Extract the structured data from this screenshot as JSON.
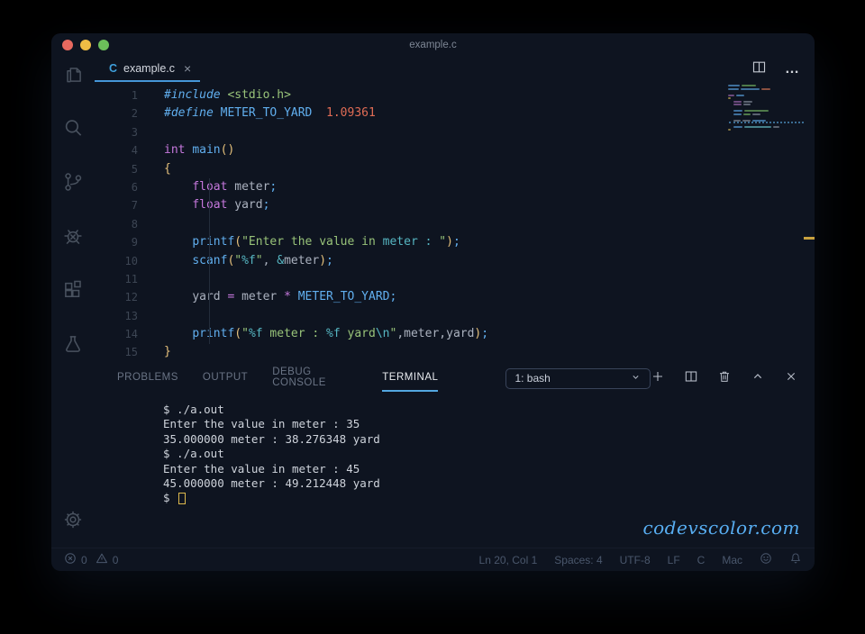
{
  "window": {
    "title": "example.c"
  },
  "tab": {
    "label": "example.c",
    "lang_badge": "C",
    "close_glyph": "×"
  },
  "editor": {
    "lines": [
      {
        "n": "1",
        "tokens": [
          [
            "#include ",
            "dir"
          ],
          [
            "<stdio.h>",
            "str"
          ]
        ]
      },
      {
        "n": "2",
        "tokens": [
          [
            "#define ",
            "dir"
          ],
          [
            "METER_TO_YARD",
            "macro"
          ],
          [
            "  ",
            "pln"
          ],
          [
            "1.09361",
            "num"
          ]
        ]
      },
      {
        "n": "3",
        "tokens": []
      },
      {
        "n": "4",
        "tokens": [
          [
            "int ",
            "kw"
          ],
          [
            "main",
            "fn"
          ],
          [
            "()",
            "br"
          ]
        ]
      },
      {
        "n": "5",
        "tokens": [
          [
            "{",
            "br"
          ]
        ]
      },
      {
        "n": "6",
        "tokens": [
          [
            "    ",
            "pln"
          ],
          [
            "float ",
            "kw"
          ],
          [
            "meter",
            "pln"
          ],
          [
            ";",
            "pun"
          ]
        ]
      },
      {
        "n": "7",
        "tokens": [
          [
            "    ",
            "pln"
          ],
          [
            "float ",
            "kw"
          ],
          [
            "yard",
            "pln"
          ],
          [
            ";",
            "pun"
          ]
        ]
      },
      {
        "n": "8",
        "tokens": []
      },
      {
        "n": "9",
        "tokens": [
          [
            "    ",
            "pln"
          ],
          [
            "printf",
            "fn"
          ],
          [
            "(",
            "br"
          ],
          [
            "\"Enter the value in ",
            "str"
          ],
          [
            "meter : ",
            "esc"
          ],
          [
            "\"",
            "str"
          ],
          [
            ")",
            "br"
          ],
          [
            ";",
            "pun"
          ]
        ]
      },
      {
        "n": "10",
        "tokens": [
          [
            "    ",
            "pln"
          ],
          [
            "scanf",
            "fn"
          ],
          [
            "(",
            "br"
          ],
          [
            "\"",
            "str"
          ],
          [
            "%f",
            "esc"
          ],
          [
            "\"",
            "str"
          ],
          [
            ", ",
            "pln"
          ],
          [
            "&",
            "esc"
          ],
          [
            "meter",
            "pln"
          ],
          [
            ")",
            "br"
          ],
          [
            ";",
            "pun"
          ]
        ]
      },
      {
        "n": "11",
        "tokens": []
      },
      {
        "n": "12",
        "tokens": [
          [
            "    ",
            "pln"
          ],
          [
            "yard ",
            "pln"
          ],
          [
            "=",
            "opr"
          ],
          [
            " meter ",
            "pln"
          ],
          [
            "*",
            "opr"
          ],
          [
            " ",
            "pln"
          ],
          [
            "METER_TO_YARD",
            "macro"
          ],
          [
            ";",
            "pun"
          ]
        ]
      },
      {
        "n": "13",
        "tokens": []
      },
      {
        "n": "14",
        "tokens": [
          [
            "    ",
            "pln"
          ],
          [
            "printf",
            "fn"
          ],
          [
            "(",
            "br"
          ],
          [
            "\"",
            "str"
          ],
          [
            "%f",
            "esc"
          ],
          [
            " meter : ",
            "str"
          ],
          [
            "%f",
            "esc"
          ],
          [
            " yard",
            "str"
          ],
          [
            "\\n",
            "esc"
          ],
          [
            "\"",
            "str"
          ],
          [
            ",meter,yard",
            "pln"
          ],
          [
            ")",
            "br"
          ],
          [
            ";",
            "pun"
          ]
        ]
      },
      {
        "n": "15",
        "tokens": [
          [
            "}",
            "br"
          ]
        ]
      }
    ]
  },
  "panel": {
    "tabs": [
      {
        "label": "PROBLEMS",
        "active": false
      },
      {
        "label": "OUTPUT",
        "active": false
      },
      {
        "label": "DEBUG CONSOLE",
        "active": false
      },
      {
        "label": "TERMINAL",
        "active": true
      }
    ],
    "dropdown_label": "1: bash"
  },
  "terminal": {
    "lines": [
      "$ ./a.out",
      "Enter the value in meter : 35",
      "35.000000 meter : 38.276348 yard",
      "$ ./a.out",
      "Enter the value in meter : 45",
      "45.000000 meter : 49.212448 yard"
    ],
    "last_prompt": "$ "
  },
  "watermark": "codevscolor.com",
  "status_bar": {
    "errors": "0",
    "warnings": "0",
    "items": [
      "Ln 20, Col 1",
      "Spaces: 4",
      "UTF-8",
      "LF",
      "C",
      "Mac"
    ]
  },
  "colors": {
    "accent_blue": "#4596d8",
    "terminal_underline": "#53a7e0",
    "string_green": "#98c379",
    "keyword_purple": "#c678dd",
    "function_blue": "#61afef",
    "number_orange": "#e06c55",
    "format_teal": "#56b6c2",
    "bracket_gold": "#e5c07b",
    "cursor_yellow": "#ddb94d",
    "watermark_blue": "#58aef2",
    "ruler_mark_yellow": "#c9a23f"
  }
}
